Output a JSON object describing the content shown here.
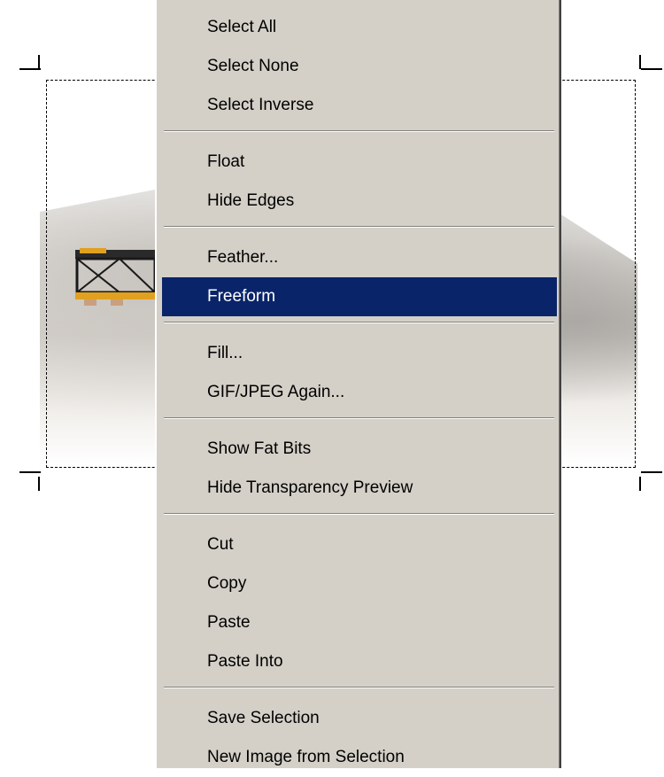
{
  "menu": {
    "groups": [
      {
        "items": [
          "Select All",
          "Select None",
          "Select Inverse"
        ]
      },
      {
        "items": [
          "Float",
          "Hide Edges"
        ]
      },
      {
        "items": [
          "Feather...",
          "Freeform"
        ]
      },
      {
        "items": [
          "Fill...",
          "GIF/JPEG Again..."
        ]
      },
      {
        "items": [
          "Show Fat Bits",
          "Hide Transparency Preview"
        ]
      },
      {
        "items": [
          "Cut",
          "Copy",
          "Paste",
          "Paste Into"
        ]
      },
      {
        "items": [
          "Save Selection",
          "New Image from Selection"
        ]
      }
    ],
    "highlighted_item": "Freeform"
  },
  "colors": {
    "menu_background": "#d4d0c8",
    "highlight_background": "#0a246a",
    "highlight_text": "#ffffff"
  }
}
